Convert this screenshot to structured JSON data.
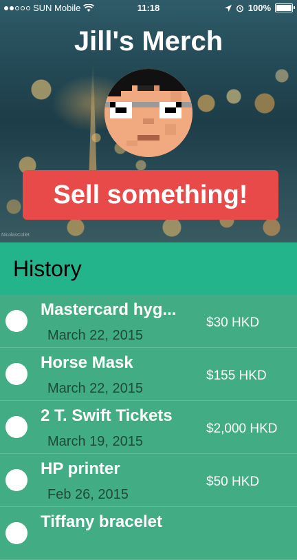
{
  "status_bar": {
    "carrier": "SUN Mobile",
    "time": "11:18",
    "battery": "100%"
  },
  "app": {
    "title": "Jill's Merch",
    "sell_button": "Sell something!"
  },
  "history": {
    "title": "History",
    "items": [
      {
        "name": "Mastercard hyg...",
        "date": "March 22, 2015",
        "price": "$30 HKD"
      },
      {
        "name": "Horse Mask",
        "date": "March 22, 2015",
        "price": "$155 HKD"
      },
      {
        "name": "2 T. Swift Tickets",
        "date": "March 19, 2015",
        "price": "$2,000 HKD"
      },
      {
        "name": "HP printer",
        "date": "Feb 26, 2015",
        "price": "$50 HKD"
      },
      {
        "name": "Tiffany bracelet",
        "date": "",
        "price": ""
      }
    ]
  },
  "watermark": "NicolasCollet",
  "colors": {
    "sell_button": "#e84a4a",
    "history_header": "#23b48b",
    "row_bg": "#42ad84"
  }
}
